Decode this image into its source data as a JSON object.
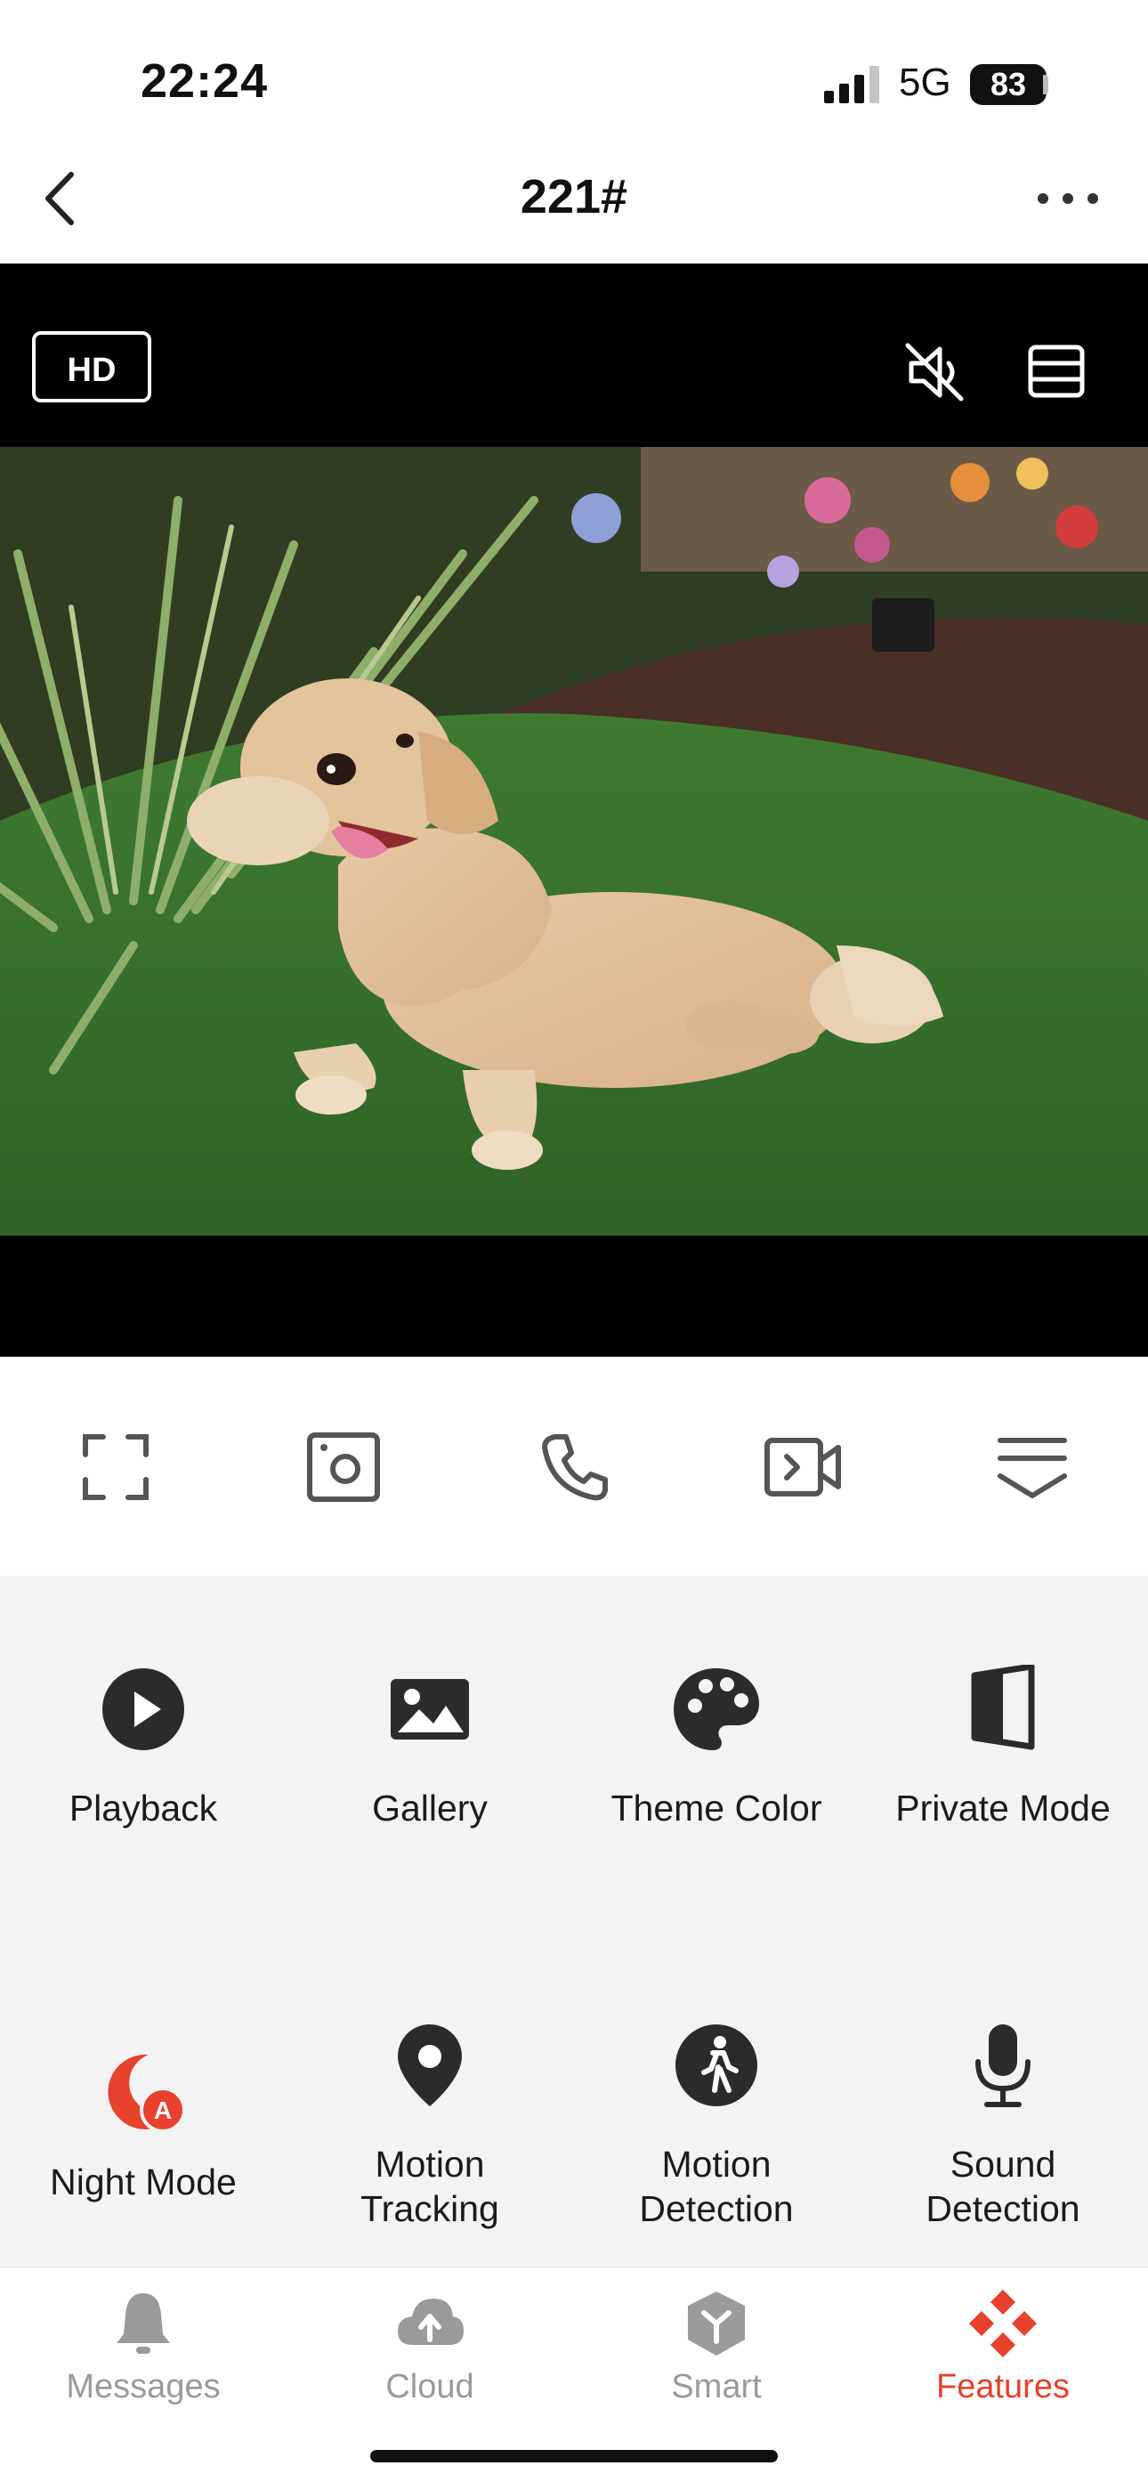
{
  "status_bar": {
    "time": "22:24",
    "network": "5G",
    "battery": "83"
  },
  "nav": {
    "title": "221#"
  },
  "video": {
    "quality_badge": "HD"
  },
  "features": [
    {
      "label": "Playback",
      "icon": "play-circle-icon"
    },
    {
      "label": "Gallery",
      "icon": "image-icon"
    },
    {
      "label": "Theme Color",
      "icon": "palette-icon"
    },
    {
      "label": "Private Mode",
      "icon": "shield-half-icon"
    },
    {
      "label": "Night Mode",
      "icon": "night-mode-auto-icon"
    },
    {
      "label": "Motion Tracking",
      "label_lines": [
        "Motion",
        "Tracking"
      ],
      "icon": "location-pin-icon"
    },
    {
      "label": "Motion Detection",
      "label_lines": [
        "Motion",
        "Detection"
      ],
      "icon": "walking-person-icon"
    },
    {
      "label": "Sound Detection",
      "label_lines": [
        "Sound",
        "Detection"
      ],
      "icon": "microphone-icon"
    }
  ],
  "tabs": [
    {
      "label": "Messages",
      "icon": "bell-icon",
      "active": false
    },
    {
      "label": "Cloud",
      "icon": "cloud-upload-icon",
      "active": false
    },
    {
      "label": "Smart",
      "icon": "smart-cube-icon",
      "active": false
    },
    {
      "label": "Features",
      "icon": "features-diamonds-icon",
      "active": true
    }
  ],
  "colors": {
    "accent": "#e8412c",
    "inactive": "#9a9a9a",
    "panel_bg": "#f3f3f3",
    "icon_dark": "#2b2b2b"
  }
}
